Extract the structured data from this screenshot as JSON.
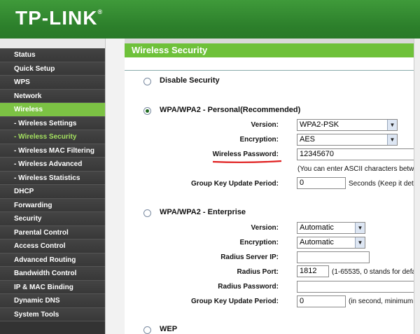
{
  "brand": {
    "name": "TP-LINK",
    "mark": "®"
  },
  "sidebar": {
    "items": [
      {
        "label": "Status"
      },
      {
        "label": "Quick Setup"
      },
      {
        "label": "WPS"
      },
      {
        "label": "Network"
      },
      {
        "label": "Wireless"
      },
      {
        "label": "- Wireless Settings"
      },
      {
        "label": "- Wireless Security"
      },
      {
        "label": "- Wireless MAC Filtering"
      },
      {
        "label": "- Wireless Advanced"
      },
      {
        "label": "- Wireless Statistics"
      },
      {
        "label": "DHCP"
      },
      {
        "label": "Forwarding"
      },
      {
        "label": "Security"
      },
      {
        "label": "Parental Control"
      },
      {
        "label": "Access Control"
      },
      {
        "label": "Advanced Routing"
      },
      {
        "label": "Bandwidth Control"
      },
      {
        "label": "IP & MAC Binding"
      },
      {
        "label": "Dynamic DNS"
      },
      {
        "label": "System Tools"
      }
    ],
    "active": "Wireless",
    "active_sub": "- Wireless Security"
  },
  "page": {
    "title": "Wireless Security"
  },
  "disable": {
    "label": "Disable Security",
    "selected": false
  },
  "personal": {
    "label": "WPA/WPA2 - Personal(Recommended)",
    "selected": true,
    "version_label": "Version:",
    "version_value": "WPA2-PSK",
    "encryption_label": "Encryption:",
    "encryption_value": "AES",
    "password_label": "Wireless Password:",
    "password_value": "12345670",
    "password_note": "(You can enter ASCII characters betw",
    "group_label": "Group Key Update Period:",
    "group_value": "0",
    "group_note": "Seconds (Keep it det"
  },
  "enterprise": {
    "label": "WPA/WPA2 - Enterprise",
    "selected": false,
    "version_label": "Version:",
    "version_value": "Automatic",
    "encryption_label": "Encryption:",
    "encryption_value": "Automatic",
    "server_label": "Radius Server IP:",
    "server_value": "",
    "port_label": "Radius Port:",
    "port_value": "1812",
    "port_note": "(1-65535, 0 stands for defa",
    "rpass_label": "Radius Password:",
    "rpass_value": "",
    "group_label": "Group Key Update Period:",
    "group_value": "0",
    "group_note": "(in second, minimum"
  },
  "wep": {
    "label": "WEP",
    "selected": false
  },
  "colors": {
    "accent": "#6ec13a",
    "header": "#2c7f2b",
    "sidebar": "#333333",
    "annotation": "#e02020"
  }
}
